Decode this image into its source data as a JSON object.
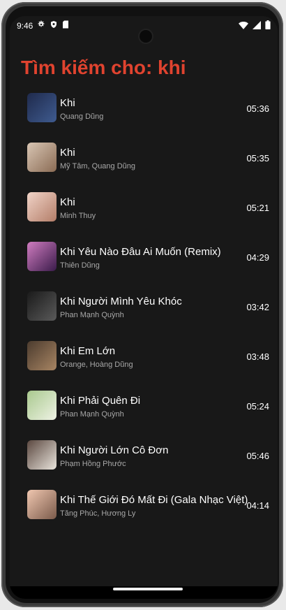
{
  "status": {
    "time": "9:46",
    "icons_left": [
      "gear-icon",
      "shield-icon",
      "sd-card-icon"
    ],
    "icons_right": [
      "wifi-icon",
      "signal-icon",
      "battery-icon"
    ]
  },
  "page": {
    "title": "Tìm kiếm cho: khi"
  },
  "songs": [
    {
      "title": "Khi",
      "artist": "Quang Dũng",
      "duration": "05:36",
      "thumb_colors": [
        "#1f2a4c",
        "#3f5b8f"
      ]
    },
    {
      "title": "Khi",
      "artist": "Mỹ Tâm, Quang Dũng",
      "duration": "05:35",
      "thumb_colors": [
        "#d9c6b4",
        "#8a6b54"
      ]
    },
    {
      "title": "Khi",
      "artist": "Minh Thuy",
      "duration": "05:21",
      "thumb_colors": [
        "#f1d4c8",
        "#b37d68"
      ]
    },
    {
      "title": "Khi Yêu Nào Đâu Ai Muốn (Remix)",
      "artist": "Thiên Dũng",
      "duration": "04:29",
      "thumb_colors": [
        "#d07cc0",
        "#3a1b4a"
      ]
    },
    {
      "title": "Khi Người Mình Yêu Khóc",
      "artist": "Phan Mạnh Quỳnh",
      "duration": "03:42",
      "thumb_colors": [
        "#1a1a1a",
        "#5a5a5a"
      ]
    },
    {
      "title": "Khi Em Lớn",
      "artist": "Orange, Hoàng Dũng",
      "duration": "03:48",
      "thumb_colors": [
        "#4b3b2e",
        "#a88563"
      ]
    },
    {
      "title": "Khi Phải Quên Đi",
      "artist": "Phan Mạnh Quỳnh",
      "duration": "05:24",
      "thumb_colors": [
        "#a9c98e",
        "#eef2e4"
      ]
    },
    {
      "title": "Khi Người Lớn Cô Đơn",
      "artist": "Phạm Hồng Phước",
      "duration": "05:46",
      "thumb_colors": [
        "#5b4840",
        "#e9e4dc"
      ]
    },
    {
      "title": "Khi Thế Giới Đó Mất Đi (Gala Nhạc Việt)",
      "artist": "Tăng Phúc, Hương Ly",
      "duration": "04:14",
      "thumb_colors": [
        "#f0c7b0",
        "#7a5a4a"
      ]
    }
  ]
}
